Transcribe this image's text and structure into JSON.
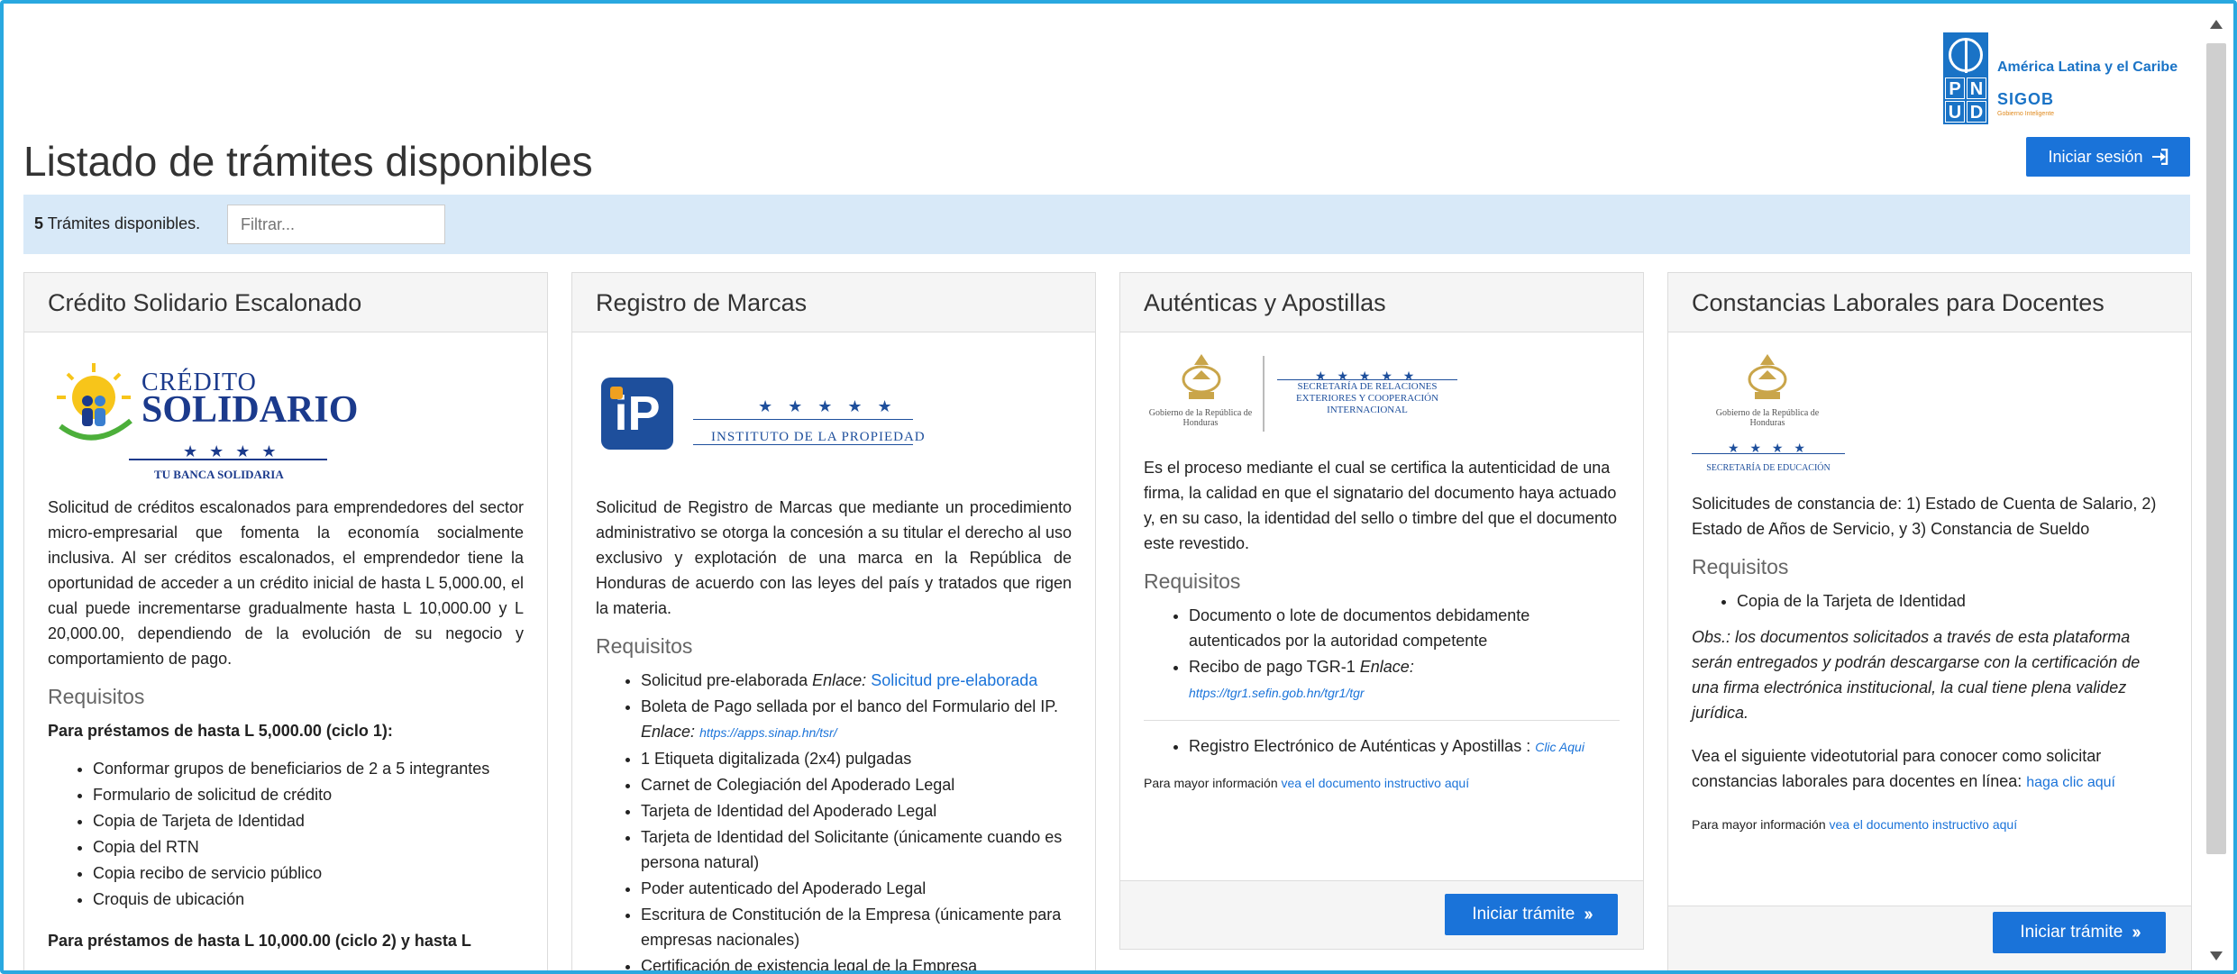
{
  "header": {
    "page_title": "Listado de trámites disponibles",
    "login_label": "Iniciar sesión",
    "logo": {
      "region": "América Latina y el Caribe",
      "sigob": "SIGOB",
      "sigob_sub": "Gobierno Inteligente",
      "undp_letters": [
        "P",
        "N",
        "U",
        "D"
      ]
    }
  },
  "filterbar": {
    "count": "5",
    "count_label": "Trámites disponibles.",
    "filter_placeholder": "Filtrar..."
  },
  "colors": {
    "accent": "#1a73d9",
    "frame": "#29a8e0",
    "filterbar_bg": "#d8e9f8",
    "card_header_bg": "#f5f5f5"
  },
  "cards": [
    {
      "title": "Crédito Solidario Escalonado",
      "logo": {
        "line1": "CRÉDITO",
        "line2": "SOLIDARIO",
        "stars": "★ ★ ★ ★",
        "tagline": "TU BANCA SOLIDARIA"
      },
      "description": "Solicitud de créditos escalonados para emprendedores del sector micro-empresarial que fomenta la economía socialmente inclusiva. Al ser créditos escalonados, el emprendedor tiene la oportunidad de acceder a un crédito inicial de hasta L 5,000.00, el cual puede incrementarse gradualmente hasta L 10,000.00 y L 20,000.00, dependiendo de la evolución de su negocio y comportamiento de pago.",
      "req_title": "Requisitos",
      "sub1": "Para préstamos de hasta L 5,000.00 (ciclo 1):",
      "items": [
        "Conformar grupos de beneficiarios de 2 a 5 integrantes",
        "Formulario de solicitud de crédito",
        "Copia de Tarjeta de Identidad",
        "Copia del RTN",
        "Copia recibo de servicio público",
        "Croquis de ubicación"
      ],
      "sub2": "Para préstamos de hasta L 10,000.00 (ciclo 2) y hasta L"
    },
    {
      "title": "Registro de Marcas",
      "logo": {
        "mark": "iP",
        "stars": "★ ★ ★ ★ ★",
        "name": "INSTITUTO DE LA PROPIEDAD"
      },
      "description": "Solicitud de Registro de Marcas que mediante un procedimiento administrativo se otorga la concesión a su titular el derecho al uso exclusivo y explotación de una marca en la República de Honduras de acuerdo con las leyes del país y tratados que rigen la materia.",
      "req_title": "Requisitos",
      "item1_text": "Solicitud pre-elaborada ",
      "item1_enlace": "Enlace:",
      "item1_link": "Solicitud pre-elaborada",
      "item2_text": "Boleta de Pago sellada por el banco del Formulario del IP. ",
      "item2_enlace": "Enlace:",
      "item2_link": "https://apps.sinap.hn/tsr/",
      "items": [
        "1 Etiqueta digitalizada (2x4) pulgadas",
        "Carnet de Colegiación del Apoderado Legal",
        "Tarjeta de Identidad del Apoderado Legal",
        "Tarjeta de Identidad del Solicitante (únicamente cuando es persona natural)",
        "Poder autenticado del Apoderado Legal",
        "Escritura de Constitución de la Empresa (únicamente para empresas nacionales)",
        "Certificación de existencia legal de la Empresa"
      ]
    },
    {
      "title": "Auténticas y Apostillas",
      "logo": {
        "gob": "Gobierno de la República de Honduras",
        "stars": "★ ★ ★ ★ ★",
        "sre": "SECRETARÍA DE RELACIONES EXTERIORES Y COOPERACIÓN INTERNACIONAL"
      },
      "description": "Es el proceso mediante el cual se certifica la autenticidad de una firma, la calidad en que el signatario del documento haya actuado y, en su caso, la identidad del sello o timbre del que el documento este revestido.",
      "req_title": "Requisitos",
      "item1": "Documento o lote de documentos debidamente autenticados por la autoridad competente",
      "item2_text": "Recibo de pago TGR-1 ",
      "item2_enlace": "Enlace:",
      "item2_link": "https://tgr1.sefin.gob.hn/tgr1/tgr",
      "item3_text": "Registro Electrónico de Auténticas y Apostillas : ",
      "item3_link": "Clic Aqui",
      "more_info": "Para mayor información ",
      "more_link": "vea el documento instructivo aquí",
      "button": "Iniciar trámite"
    },
    {
      "title": "Constancias Laborales para Docentes",
      "logo": {
        "gob": "Gobierno de la República de Honduras",
        "stars": "★ ★ ★ ★",
        "edu": "SECRETARÍA DE EDUCACIÓN"
      },
      "description": "Solicitudes de constancia de: 1) Estado de Cuenta de Salario, 2) Estado de Años de Servicio, y 3) Constancia de Sueldo",
      "req_title": "Requisitos",
      "item1": "Copia de la Tarjeta de Identidad",
      "obs": "Obs.: los documentos solicitados a través de esta plataforma serán entregados y podrán descargarse con la certificación de una firma electrónica institucional, la cual tiene plena validez jurídica.",
      "video_text": "Vea el siguiente videotutorial para conocer como solicitar constancias laborales para docentes en línea: ",
      "video_link": "haga clic aquí",
      "more_info": "Para mayor información ",
      "more_link": "vea el documento instructivo aquí",
      "button": "Iniciar trámite"
    }
  ]
}
